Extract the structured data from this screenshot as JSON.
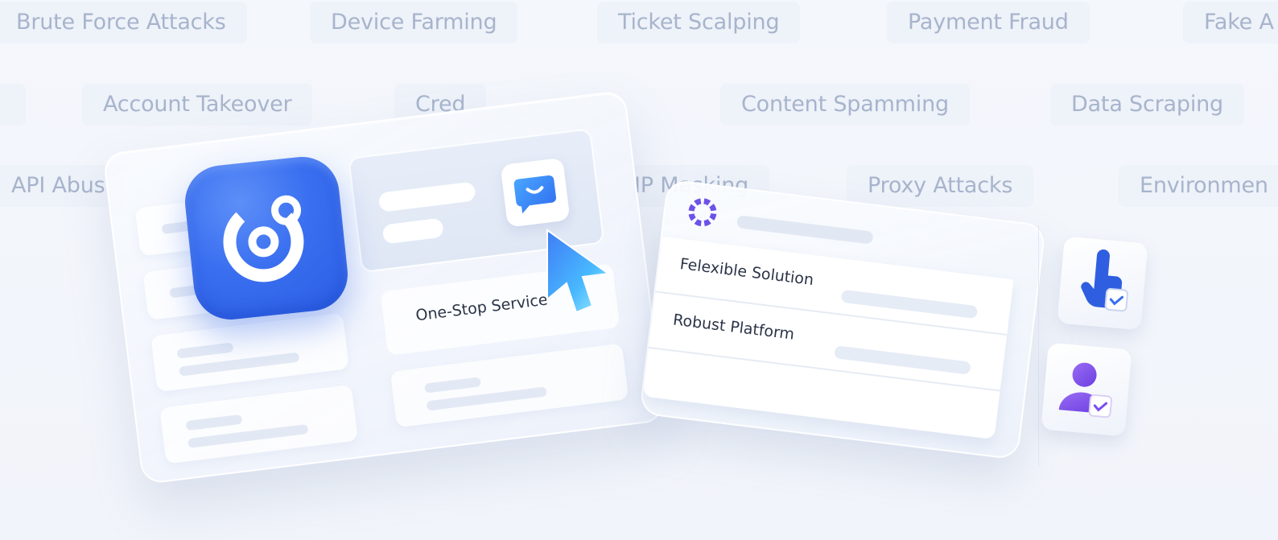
{
  "threat_tags": [
    "Brute Force Attacks",
    "Device Farming",
    "Ticket Scalping",
    "Payment Fraud",
    "Fake A",
    "Account Takeover",
    "Cred",
    "Content Spamming",
    "Data Scraping",
    "API Abus",
    "IP Masking",
    "Proxy Attacks",
    "Environmen"
  ],
  "dashboard": {
    "service_label": "One-Stop Service"
  },
  "solution_card": {
    "rows": [
      {
        "label": "Felexible Solution"
      },
      {
        "label": "Robust Platform"
      }
    ]
  },
  "colors": {
    "background": "#f3f6fb",
    "tag_text": "#a7b4cc",
    "brand_blue": "#3a6ff0",
    "accent_purple": "#7b4ef0",
    "text_dark": "#2a3447"
  },
  "icons": {
    "app": "brand-g-icon",
    "chat": "chat-smile-icon",
    "cursor": "pointer-cursor-icon",
    "ring": "dotted-ring-icon",
    "tap": "hand-tap-icon",
    "user": "user-icon",
    "check": "check-badge-icon"
  }
}
